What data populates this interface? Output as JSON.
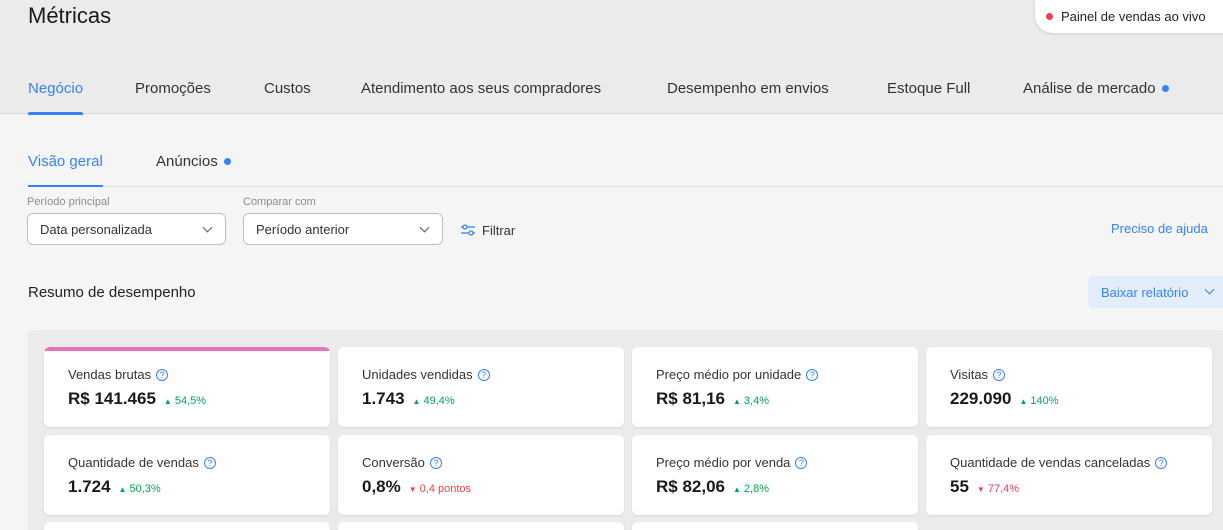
{
  "page": {
    "title": "Métricas"
  },
  "live_panel": {
    "label": "Painel de vendas ao vivo"
  },
  "tabs": [
    {
      "label": "Negócio",
      "active": true
    },
    {
      "label": "Promoções"
    },
    {
      "label": "Custos"
    },
    {
      "label": "Atendimento aos seus compradores"
    },
    {
      "label": "Desempenho em envios"
    },
    {
      "label": "Estoque Full"
    },
    {
      "label": "Análise de mercado",
      "dot": true
    }
  ],
  "subtabs": [
    {
      "label": "Visão geral",
      "active": true
    },
    {
      "label": "Anúncios",
      "dot": true
    }
  ],
  "filters": {
    "main_period_label": "Período principal",
    "main_period_value": "Data personalizada",
    "compare_label": "Comparar com",
    "compare_value": "Período anterior",
    "filter_label": "Filtrar"
  },
  "help_link": "Preciso de ajuda",
  "summary": {
    "title": "Resumo de desempenho",
    "download_label": "Baixar relatório"
  },
  "metrics": [
    {
      "label": "Vendas brutas",
      "value": "R$ 141.465",
      "delta": "54,5%",
      "trend": "up",
      "highlight": true
    },
    {
      "label": "Unidades vendidas",
      "value": "1.743",
      "delta": "49,4%",
      "trend": "up"
    },
    {
      "label": "Preço médio por unidade",
      "value": "R$ 81,16",
      "delta": "3,4%",
      "trend": "up"
    },
    {
      "label": "Visitas",
      "value": "229.090",
      "delta": "140%",
      "trend": "up"
    },
    {
      "label": "Quantidade de vendas",
      "value": "1.724",
      "delta": "50,3%",
      "trend": "up"
    },
    {
      "label": "Conversão",
      "value": "0,8%",
      "delta": "0,4 pontos",
      "trend": "down"
    },
    {
      "label": "Preço médio por venda",
      "value": "R$ 82,06",
      "delta": "2,8%",
      "trend": "up"
    },
    {
      "label": "Quantidade de vendas canceladas",
      "value": "55",
      "delta": "77,4%",
      "trend": "down"
    }
  ],
  "colors": {
    "accent": "#3483fa",
    "highlight": "#e773b9",
    "positive": "#00a650",
    "negative": "#f23d4f"
  },
  "icons": {
    "help": "question-circle-icon",
    "filter": "sliders-icon",
    "dropdown": "chevron-down-icon",
    "status": "red-dot-icon"
  }
}
